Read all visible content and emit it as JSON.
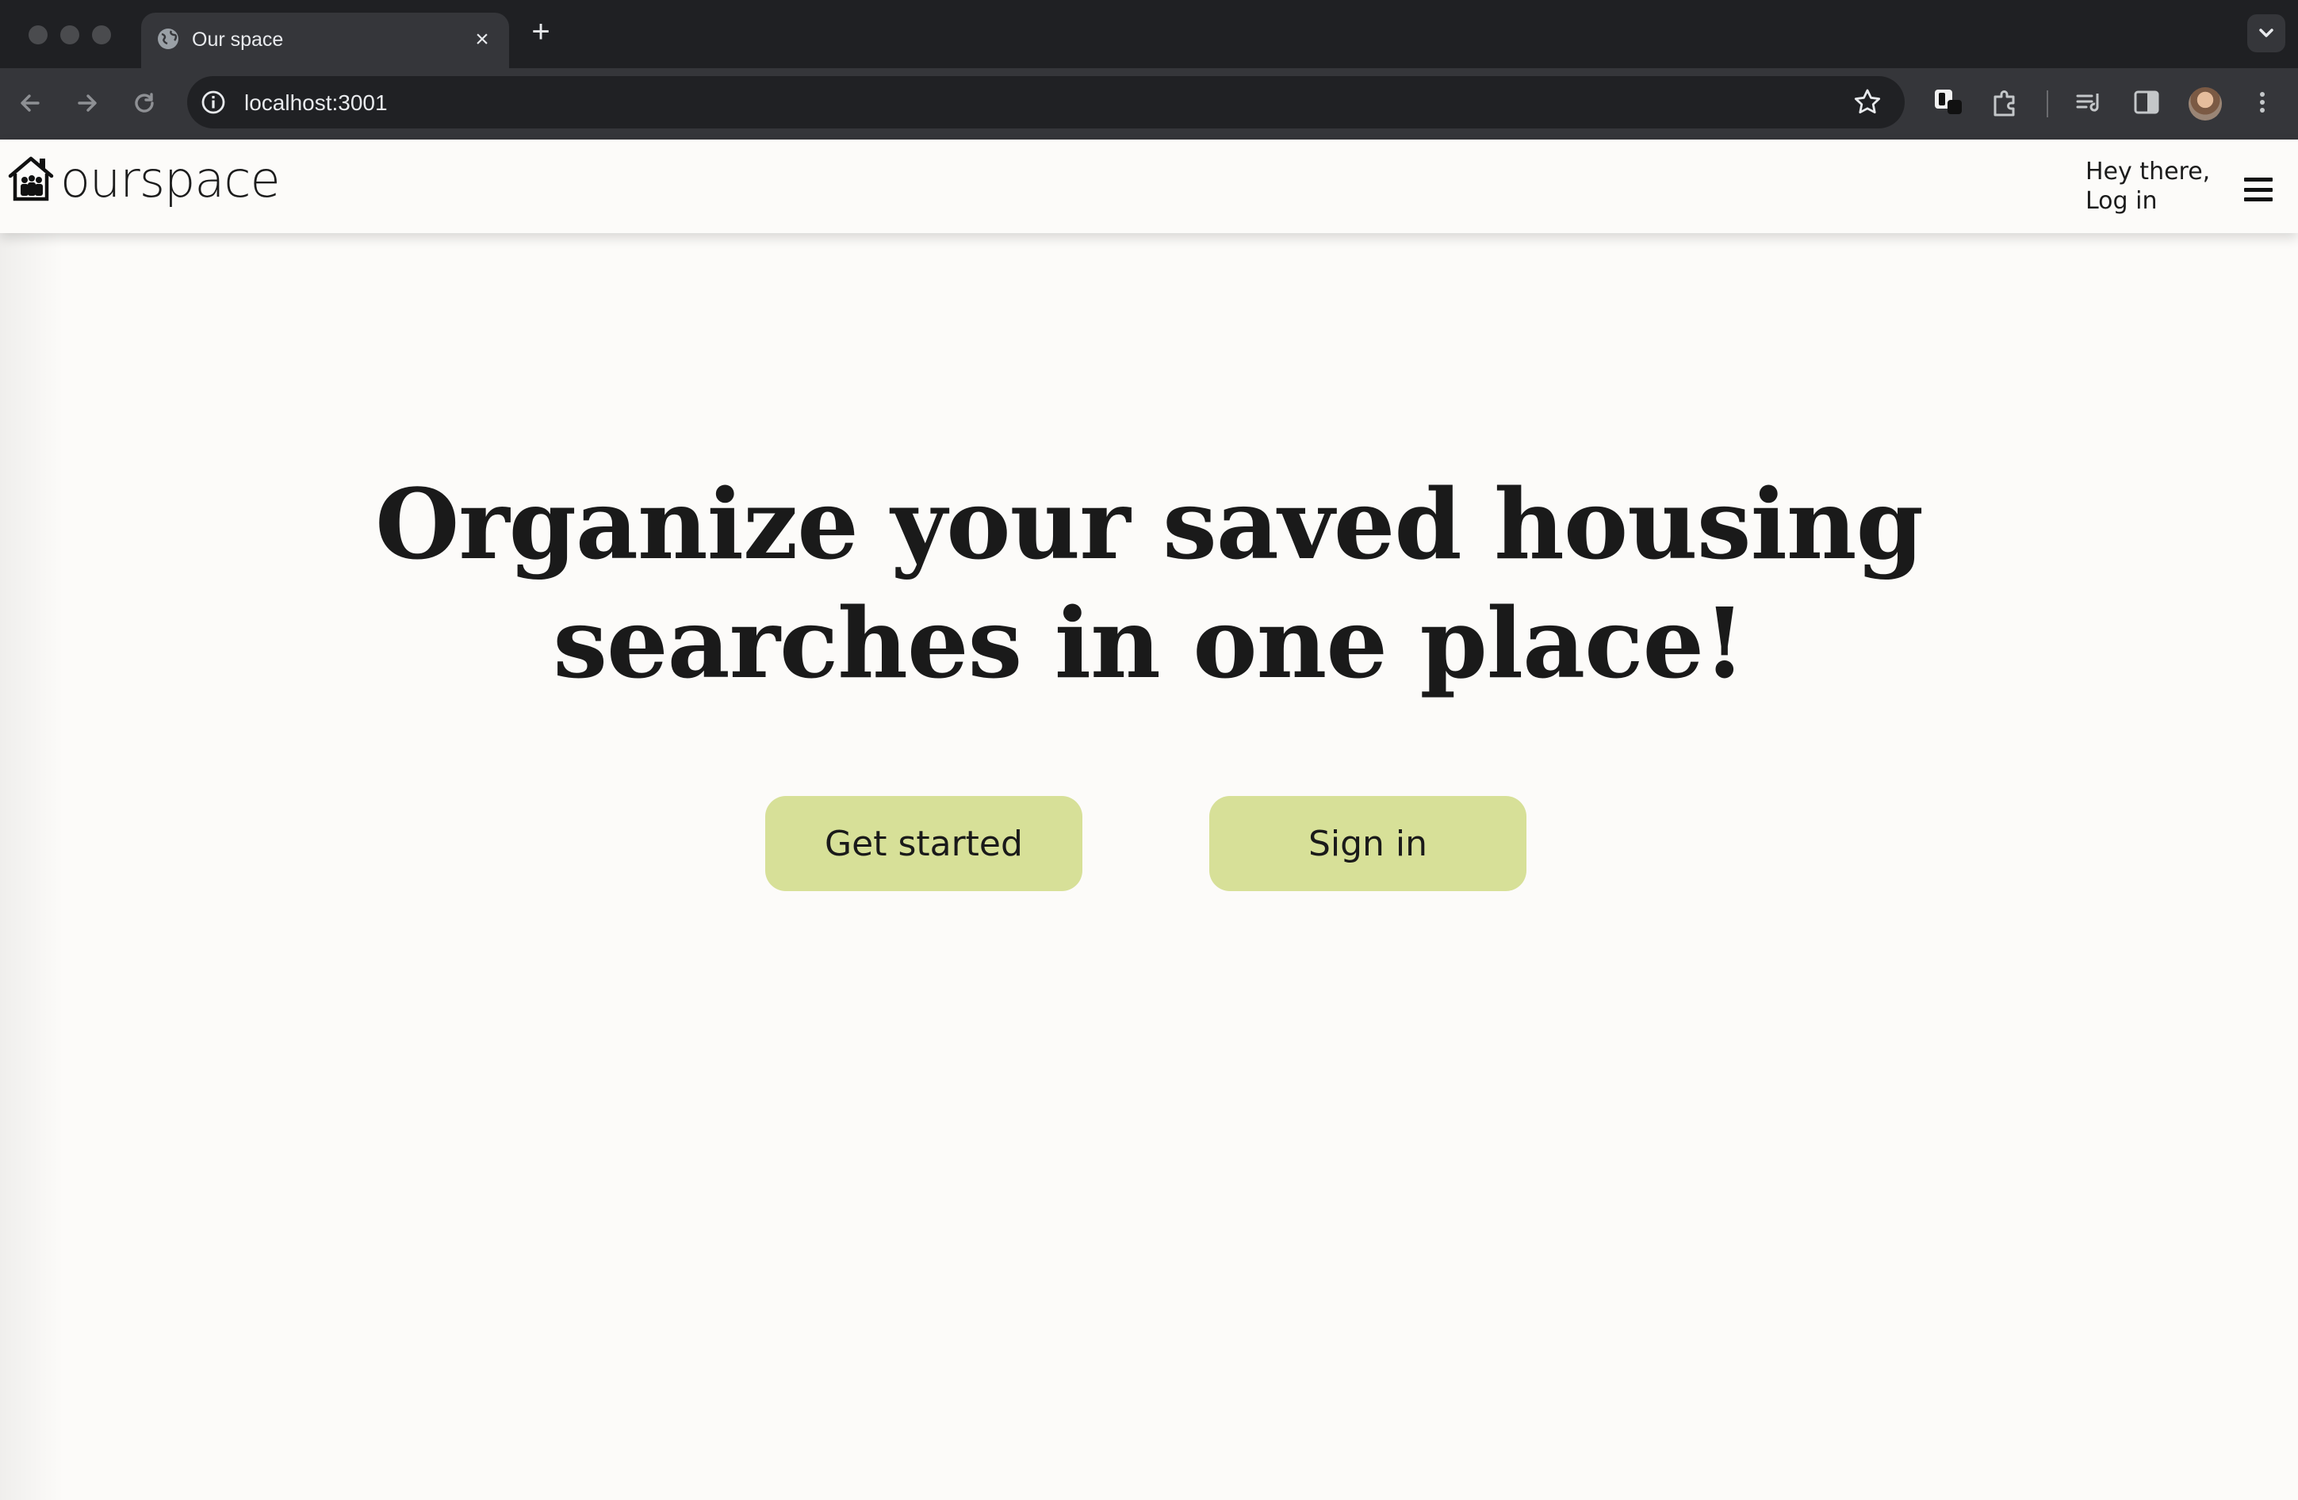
{
  "browser": {
    "tab": {
      "title": "Our space",
      "close_icon": "close-icon",
      "favicon": "globe-icon"
    },
    "new_tab_icon": "plus-icon",
    "address": {
      "url": "localhost:3001"
    }
  },
  "site": {
    "logo_text": "ourspace",
    "logo_icon": "house-people-icon",
    "greeting": "Hey there,",
    "login_label": "Log in",
    "menu_icon": "hamburger-menu-icon"
  },
  "hero": {
    "headline": "Organize your saved housing searches in one place!"
  },
  "actions": {
    "get_started_label": "Get started",
    "sign_in_label": "Sign in"
  },
  "colors": {
    "page_background": "#fcfbf9",
    "button_background": "#d7e098",
    "text": "#1a1a1a",
    "browser_chrome": "#35363a"
  }
}
